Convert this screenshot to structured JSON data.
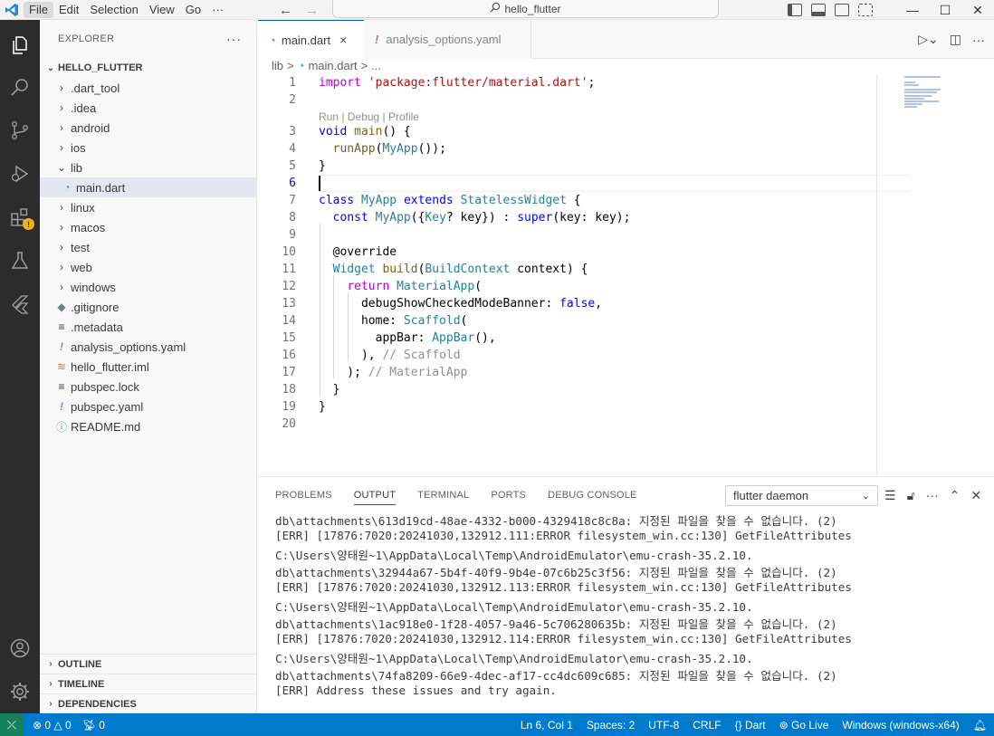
{
  "titlebar": {
    "menu": [
      "File",
      "Edit",
      "Selection",
      "View",
      "Go",
      "···"
    ],
    "search_text": "hello_flutter"
  },
  "sidebar": {
    "title": "EXPLORER",
    "more": "···",
    "project": "HELLO_FLUTTER",
    "items": [
      {
        "label": ".dart_tool",
        "type": "folder"
      },
      {
        "label": ".idea",
        "type": "folder"
      },
      {
        "label": "android",
        "type": "folder"
      },
      {
        "label": "ios",
        "type": "folder"
      },
      {
        "label": "lib",
        "type": "folder-open"
      },
      {
        "label": "main.dart",
        "type": "dart",
        "selected": true
      },
      {
        "label": "linux",
        "type": "folder"
      },
      {
        "label": "macos",
        "type": "folder"
      },
      {
        "label": "test",
        "type": "folder"
      },
      {
        "label": "web",
        "type": "folder"
      },
      {
        "label": "windows",
        "type": "folder"
      },
      {
        "label": ".gitignore",
        "type": "git"
      },
      {
        "label": ".metadata",
        "type": "plain"
      },
      {
        "label": "analysis_options.yaml",
        "type": "yaml"
      },
      {
        "label": "hello_flutter.iml",
        "type": "rss"
      },
      {
        "label": "pubspec.lock",
        "type": "plain"
      },
      {
        "label": "pubspec.yaml",
        "type": "yaml"
      },
      {
        "label": "README.md",
        "type": "info"
      }
    ],
    "sections": [
      "OUTLINE",
      "TIMELINE",
      "DEPENDENCIES"
    ]
  },
  "tabs": [
    {
      "label": "main.dart",
      "active": true,
      "close": "×"
    },
    {
      "label": "analysis_options.yaml",
      "active": false
    }
  ],
  "breadcrumb": {
    "folder": "lib",
    "sep": ">",
    "file": "main.dart",
    "more": "> ..."
  },
  "editor": {
    "codelens": "Run | Debug | Profile",
    "line_numbers": [
      "1",
      "2",
      "3",
      "4",
      "5",
      "6",
      "7",
      "8",
      "9",
      "10",
      "11",
      "12",
      "13",
      "14",
      "15",
      "16",
      "17",
      "18",
      "19",
      "20"
    ]
  },
  "panel": {
    "tabs": [
      "PROBLEMS",
      "OUTPUT",
      "TERMINAL",
      "PORTS",
      "DEBUG CONSOLE"
    ],
    "active_tab": "OUTPUT",
    "output_channel": "flutter daemon",
    "lines": [
      "db\\attachments\\613d19cd-48ae-4332-b000-4329418c8c8a: 지정된 파일을 찾을 수 없습니다. (2)",
      "[ERR] [17876:7020:20241030,132912.111:ERROR filesystem_win.cc:130] GetFileAttributes",
      "C:\\Users\\양태원~1\\AppData\\Local\\Temp\\AndroidEmulator\\emu-crash-35.2.10.",
      "db\\attachments\\32944a67-5b4f-40f9-9b4e-07c6b25c3f56: 지정된 파일을 찾을 수 없습니다. (2)",
      "[ERR] [17876:7020:20241030,132912.113:ERROR filesystem_win.cc:130] GetFileAttributes",
      "C:\\Users\\양태원~1\\AppData\\Local\\Temp\\AndroidEmulator\\emu-crash-35.2.10.",
      "db\\attachments\\1ac918e0-1f28-4057-9a46-5c706280635b: 지정된 파일을 찾을 수 없습니다. (2)",
      "[ERR] [17876:7020:20241030,132912.114:ERROR filesystem_win.cc:130] GetFileAttributes",
      "C:\\Users\\양태원~1\\AppData\\Local\\Temp\\AndroidEmulator\\emu-crash-35.2.10.",
      "db\\attachments\\74fa8209-66e9-4dec-af17-cc4dc609c685: 지정된 파일을 찾을 수 없습니다. (2)",
      "[ERR] Address these issues and try again."
    ]
  },
  "statusbar": {
    "errors": "0",
    "warnings": "0",
    "ports": "0",
    "position": "Ln 6, Col 1",
    "spaces": "Spaces: 2",
    "encoding": "UTF-8",
    "eol": "CRLF",
    "language": "Dart",
    "golive": "Go Live",
    "device": "Windows (windows-x64)"
  },
  "colors": {
    "accent": "#007acc",
    "activity_bar": "#2c2c2c",
    "remote": "#16825d"
  }
}
